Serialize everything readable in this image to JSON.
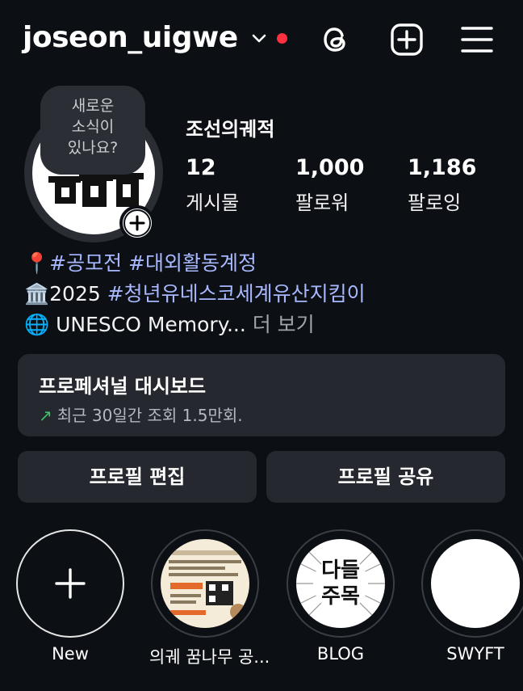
{
  "header": {
    "username": "joseon_uigwe",
    "icons": [
      "chevron-down-icon",
      "threads-icon",
      "create-post-icon",
      "menu-icon"
    ],
    "notification_dot_color": "#ff3040"
  },
  "profile": {
    "note_bubble": [
      "새로운",
      "소식이",
      "있나요?"
    ],
    "display_name": "조선의궤적",
    "stats": [
      {
        "value": "12",
        "label": "게시물"
      },
      {
        "value": "1,000",
        "label": "팔로워"
      },
      {
        "value": "1,186",
        "label": "팔로잉"
      }
    ]
  },
  "bio": {
    "line1": {
      "emoji": "📍",
      "tag1": "#공모전",
      "tag2": "#대외활동계정"
    },
    "line2": {
      "emoji": "🏛️",
      "text": "2025 ",
      "tag": "#청년유네스코세계유산지킴이"
    },
    "line3": {
      "emoji": "🌐",
      "text": " UNESCO Memory...",
      "more": " 더 보기"
    }
  },
  "dashboard": {
    "title": "프로페셔널 대시보드",
    "arrow": "↗",
    "subtitle": "최근 30일간 조회 1.5만회."
  },
  "buttons": {
    "edit_profile": "프로필 편집",
    "share_profile": "프로필 공유"
  },
  "highlights": [
    {
      "label": "New"
    },
    {
      "label": "의궤 꿈나무 공..."
    },
    {
      "label": "BLOG"
    },
    {
      "label": "SWYFT"
    }
  ],
  "highlight_art": {
    "blog_text_line1": "다들",
    "blog_text_line2": "주목"
  },
  "colors": {
    "background": "#0c0f14",
    "card": "#25282e",
    "hashtag": "#a8b8ff",
    "trend_up": "#3fc16b"
  }
}
